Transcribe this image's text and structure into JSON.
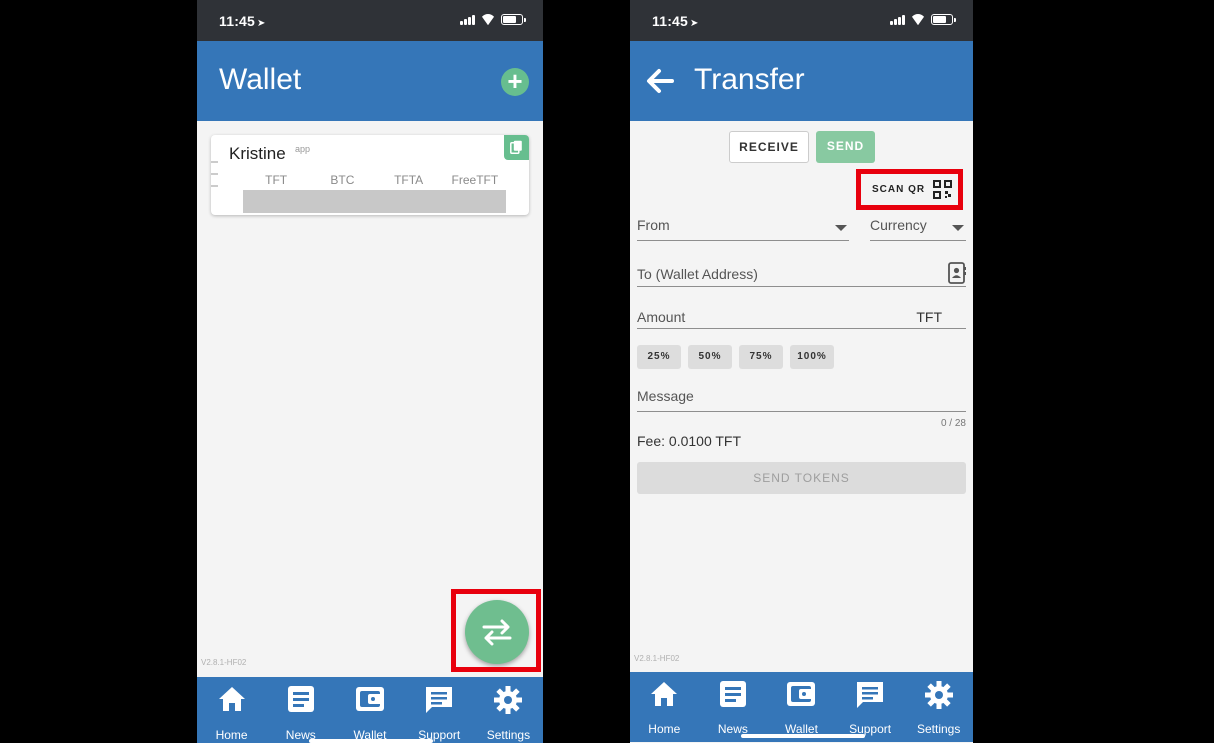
{
  "status_bar": {
    "time": "11:45"
  },
  "wallet_screen": {
    "title": "Wallet",
    "wallet": {
      "name": "Kristine",
      "tag": "app",
      "currencies": [
        "TFT",
        "BTC",
        "TFTA",
        "FreeTFT"
      ]
    },
    "version": "V2.8.1-HF02"
  },
  "transfer_screen": {
    "title": "Transfer",
    "toggle": {
      "receive": "RECEIVE",
      "send": "SEND"
    },
    "scan_qr": "SCAN QR",
    "from_label": "From",
    "currency_label": "Currency",
    "to_label": "To (Wallet Address)",
    "amount_label": "Amount",
    "amount_unit": "TFT",
    "percent_buttons": [
      "25%",
      "50%",
      "75%",
      "100%"
    ],
    "message_label": "Message",
    "message_counter": "0 / 28",
    "fee": "Fee: 0.0100 TFT",
    "send_tokens": "SEND TOKENS",
    "version": "V2.8.1-HF02"
  },
  "bottom_nav": [
    "Home",
    "News",
    "Wallet",
    "Support",
    "Settings"
  ],
  "colors": {
    "primary": "#3576b8",
    "accent": "#67be8f",
    "highlight": "#e8000d",
    "status_bar": "#2f3237"
  }
}
